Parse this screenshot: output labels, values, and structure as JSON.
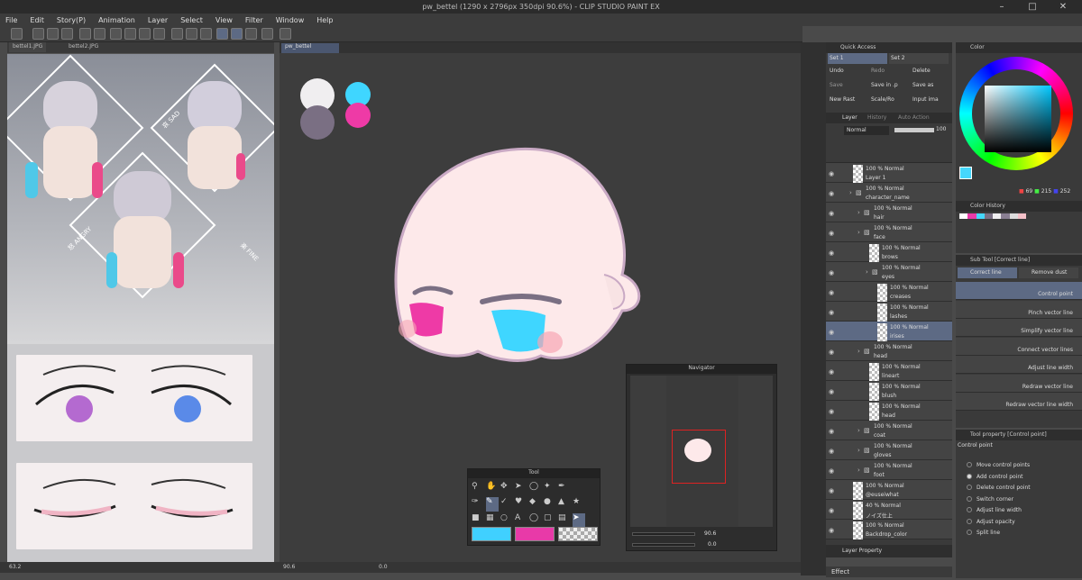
{
  "window": {
    "title": "pw_bettel (1290 x 2796px 350dpi 90.6%) - CLIP STUDIO PAINT EX"
  },
  "menu": [
    "File",
    "Edit",
    "Story(P)",
    "Animation",
    "Layer",
    "Select",
    "View",
    "Filter",
    "Window",
    "Help"
  ],
  "sub_tabs": {
    "ref1": "bettel1.JPG",
    "ref2": "bettel2.JPG",
    "canvas": "pw_bettel"
  },
  "ref_labels": {
    "angry": "怒 ANGRY",
    "sad": "哀 SAD",
    "fine": "楽 FINE"
  },
  "canvas": {
    "zoom": "90.6",
    "bg_color": "#3d3d3d",
    "swatches": [
      "#f0eef0",
      "#7a6f83",
      "#3fd6ff",
      "#ee3aa6"
    ]
  },
  "status": {
    "left_zoom": "63.2",
    "canvas_zoom": "90.6",
    "angle": "0.0"
  },
  "tool_panel": {
    "title": "Tool",
    "main_color": "#40d0ff",
    "sub_color": "#e83aa8"
  },
  "navigator": {
    "title": "Navigator",
    "zoom": "90.6",
    "angle": "0.0"
  },
  "quick_access": {
    "title": "Quick Access",
    "sets": [
      "Set 1",
      "Set 2"
    ],
    "buttons": [
      "Undo",
      "Redo",
      "Delete",
      "Save",
      "Save in .p",
      "Save as",
      "New Rast",
      "Scale/Ro",
      "Input ima"
    ]
  },
  "layer_panel": {
    "tabs": [
      "Layer",
      "History",
      "Auto Action"
    ],
    "blend": "Normal",
    "opacity": "100",
    "rows": [
      {
        "mode": "100 % Normal",
        "name": "Layer 1",
        "indent": 0,
        "type": "layer"
      },
      {
        "mode": "100 % Normal",
        "name": "character_name",
        "indent": 0,
        "type": "folder"
      },
      {
        "mode": "100 % Normal",
        "name": "hair",
        "indent": 1,
        "type": "folder"
      },
      {
        "mode": "100 % Normal",
        "name": "face",
        "indent": 1,
        "type": "folder"
      },
      {
        "mode": "100 % Normal",
        "name": "brows",
        "indent": 2,
        "type": "layer"
      },
      {
        "mode": "100 % Normal",
        "name": "eyes",
        "indent": 2,
        "type": "folder"
      },
      {
        "mode": "100 % Normal",
        "name": "creases",
        "indent": 3,
        "type": "layer"
      },
      {
        "mode": "100 % Normal",
        "name": "lashes",
        "indent": 3,
        "type": "layer"
      },
      {
        "mode": "100 % Normal",
        "name": "irises",
        "indent": 3,
        "type": "layer"
      },
      {
        "mode": "100 % Normal",
        "name": "head",
        "indent": 1,
        "type": "folder"
      },
      {
        "mode": "100 % Normal",
        "name": "lineart",
        "indent": 2,
        "type": "layer"
      },
      {
        "mode": "100 % Normal",
        "name": "blush",
        "indent": 2,
        "type": "layer"
      },
      {
        "mode": "100 % Normal",
        "name": "head",
        "indent": 2,
        "type": "layer"
      },
      {
        "mode": "100 % Normal",
        "name": "coat",
        "indent": 1,
        "type": "folder"
      },
      {
        "mode": "100 % Normal",
        "name": "gloves",
        "indent": 1,
        "type": "folder"
      },
      {
        "mode": "100 % Normal",
        "name": "foot",
        "indent": 1,
        "type": "folder"
      },
      {
        "mode": "100 % Normal",
        "name": "@euseiwhat",
        "indent": 0,
        "type": "layer"
      },
      {
        "mode": "40 % Normal",
        "name": "ノイズ仕上",
        "indent": 0,
        "type": "layer"
      },
      {
        "mode": "100 % Normal",
        "name": "Backdrop_color",
        "indent": 0,
        "type": "layer"
      }
    ],
    "bottom_tabs": [
      "Layer Property"
    ],
    "effect": "Effect"
  },
  "color_panel": {
    "title": "Color",
    "r": "69",
    "g": "215",
    "b": "252",
    "main": "#45d7fc",
    "sub": "#e83aa8"
  },
  "color_history": {
    "title": "Color History"
  },
  "sub_tool": {
    "title": "Sub Tool [Correct line]",
    "tabs": [
      "Correct line",
      "Remove dust"
    ],
    "items": [
      "Control point",
      "Pinch vector line",
      "Simplify vector line",
      "Connect vector lines",
      "Adjust line width",
      "Redraw vector line",
      "Redraw vector line width"
    ]
  },
  "tool_property": {
    "title": "Tool property [Control point]",
    "heading": "Control point",
    "options": [
      "Move control points",
      "Add control point",
      "Delete control point",
      "Switch corner",
      "Adjust line width",
      "Adjust opacity",
      "Split line"
    ],
    "selected": 1
  }
}
